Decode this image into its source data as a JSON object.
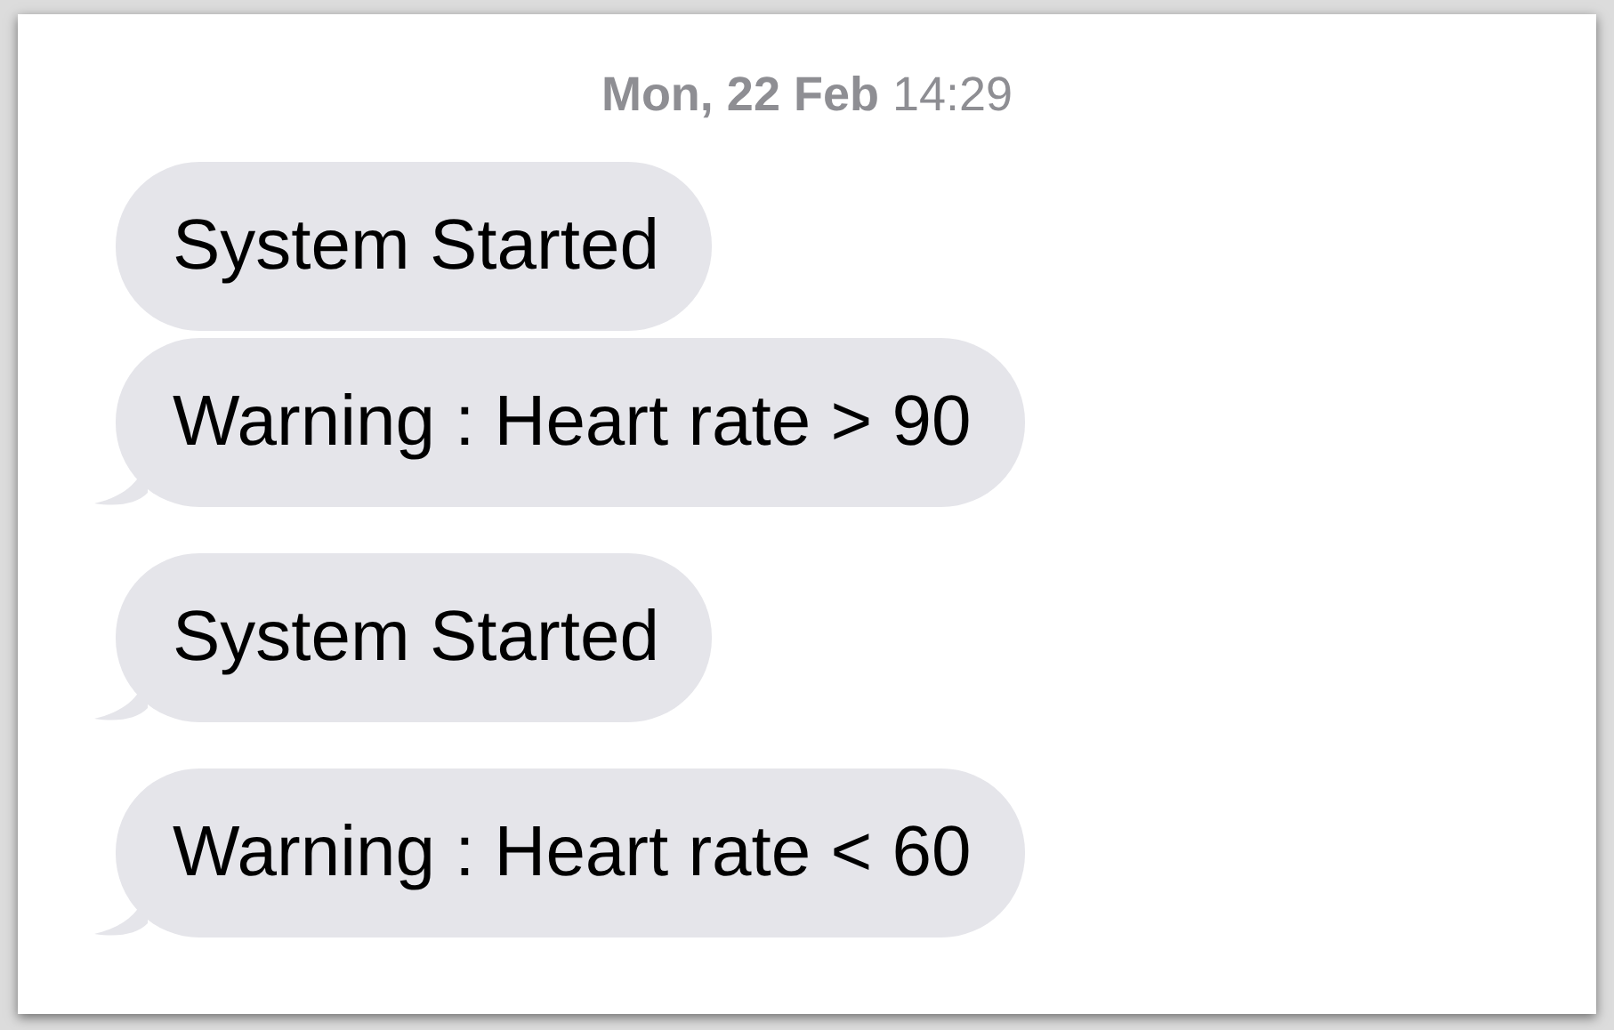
{
  "timestamp": "**Mon, 22 Feb** 14:29",
  "messages": [
    {
      "text": "System Started",
      "tail": false
    },
    {
      "text": "Warning : Heart rate > 90",
      "tail": true
    },
    {
      "text": "System Started",
      "tail": true
    },
    {
      "text": "Warning : Heart rate < 60",
      "tail": true
    }
  ]
}
